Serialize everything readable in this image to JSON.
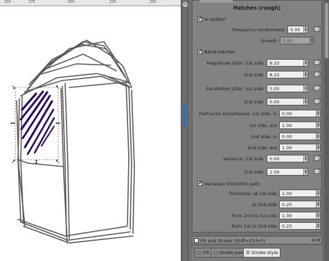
{
  "ruler": {
    "labels": [
      "150",
      "175",
      "200",
      "225",
      "250"
    ]
  },
  "dialog": {
    "title": "Hatches (rough)",
    "is_visible": {
      "label": "Is visible?",
      "checked": true
    },
    "frequency_randomness": {
      "label": "Frequency randomness",
      "value": "5.00"
    },
    "growth": {
      "label": "Growth",
      "value": "0.00"
    },
    "bend_hatches": {
      "label": "Bend hatches",
      "checked": true
    },
    "magnitude_1st": {
      "label": "Magnitude jitter: 1st side",
      "value": "8.22"
    },
    "magnitude_2nd": {
      "label": "2nd side",
      "value": "8.22"
    },
    "parallelism_1st": {
      "label": "Parallelism jitter: 1st side",
      "value": "5.00"
    },
    "parallelism_2nd": {
      "label": "2nd side",
      "value": "0.00"
    },
    "half_turns_1st_in": {
      "label": "Half-turns smoothness: 1st side, in",
      "value": "0.00"
    },
    "half_turns_1st_out": {
      "label": "1st side, out",
      "value": "1.00"
    },
    "half_turns_2nd_in": {
      "label": "2nd side, in",
      "value": "0.00"
    },
    "half_turns_2nd_out": {
      "label": "2nd side, out",
      "value": "1.00"
    },
    "variance_1st": {
      "label": "Variance: 1st side",
      "value": "0.00"
    },
    "variance_2nd": {
      "label": "2nd side",
      "value": "1.00"
    },
    "thick_thin": {
      "label": "Generate thick/thin path",
      "checked": true
    },
    "thickness_1st": {
      "label": "Thickness: at 1st side",
      "value": "1.00"
    },
    "thickness_2nd": {
      "label": "at 2nd side",
      "value": "0.25"
    },
    "thickness_2to1": {
      "label": "from 2nd to 1st side",
      "value": "1.00"
    },
    "thickness_1to2": {
      "label": "from 1st to 2nd side",
      "value": "0.25"
    }
  },
  "fill_stroke": {
    "title": "Fill and Stroke (Shift+Ctrl+F)",
    "header_icons": "⊟ ⊠",
    "tabs": {
      "fill": "Fill",
      "stroke_paint": "Stroke paint",
      "stroke_style": "Stroke style"
    },
    "active_tab": "stroke_style"
  },
  "colors": {
    "hatch": "#2b0a5e",
    "stroke": "#555555",
    "handle": "#000000"
  }
}
